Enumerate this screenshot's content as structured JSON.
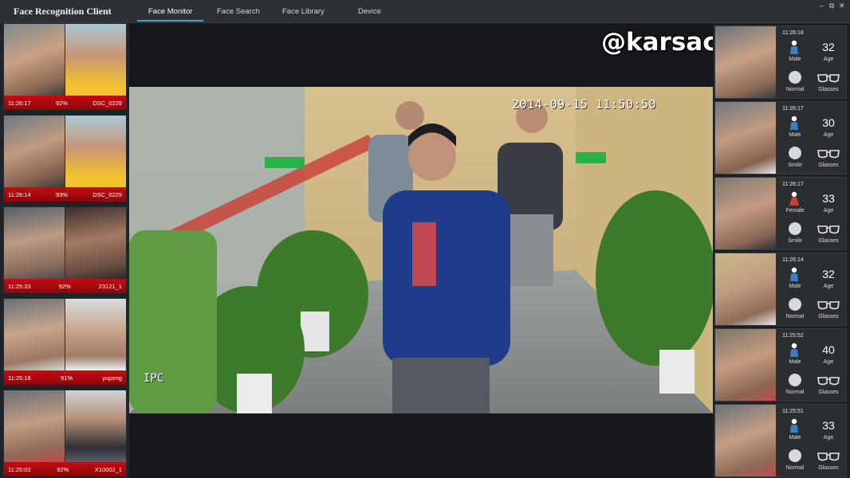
{
  "app": {
    "title": "Face Recognition Client"
  },
  "tabs": [
    {
      "label": "Face Monitor",
      "active": true
    },
    {
      "label": "Face Search",
      "active": false
    },
    {
      "label": "Face Library",
      "active": false
    },
    {
      "label": "Device",
      "active": false
    }
  ],
  "window_controls": {
    "minimize": "–",
    "restore": "⧉",
    "close": "✕"
  },
  "matches": [
    {
      "time": "11:26:17",
      "score": "92%",
      "name": "DSC_0229"
    },
    {
      "time": "11:26:14",
      "score": "93%",
      "name": "DSC_0229"
    },
    {
      "time": "11:25:33",
      "score": "92%",
      "name": "23121_1"
    },
    {
      "time": "11:25:18",
      "score": "91%",
      "name": "yupeng"
    },
    {
      "time": "11:25:02",
      "score": "92%",
      "name": "X10002_1"
    }
  ],
  "video": {
    "timestamp": "2014-09-15 11:50:50",
    "camera_label": "IPC",
    "watermark": "@karsacliaam"
  },
  "attributes": [
    {
      "time": "11:26:18",
      "gender": "Male",
      "age": "32",
      "age_label": "Age",
      "expression": "Normal",
      "glasses": "Glasses"
    },
    {
      "time": "11:26:17",
      "gender": "Male",
      "age": "30",
      "age_label": "Age",
      "expression": "Smile",
      "glasses": "Glasses"
    },
    {
      "time": "11:26:17",
      "gender": "Female",
      "age": "33",
      "age_label": "Age",
      "expression": "Smile",
      "glasses": "Glasses"
    },
    {
      "time": "11:26:14",
      "gender": "Male",
      "age": "32",
      "age_label": "Age",
      "expression": "Normal",
      "glasses": "Glasses"
    },
    {
      "time": "11:25:52",
      "gender": "Male",
      "age": "40",
      "age_label": "Age",
      "expression": "Normal",
      "glasses": "Glasses"
    },
    {
      "time": "11:25:51",
      "gender": "Male",
      "age": "33",
      "age_label": "Age",
      "expression": "Normal",
      "glasses": "Glasses"
    }
  ],
  "colors": {
    "accent": "#3aa3e0",
    "match_bar": "#c20d12",
    "male_icon": "#3a7fc8",
    "female_icon": "#d23a3a"
  }
}
